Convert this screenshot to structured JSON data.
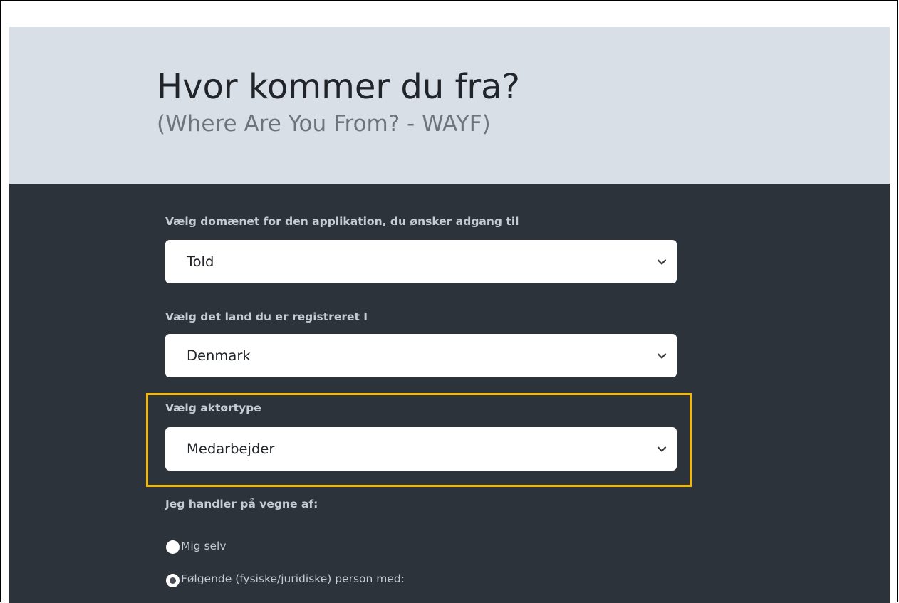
{
  "header": {
    "title": "Hvor kommer du fra?",
    "subtitle": "(Where Are You From? - WAYF)"
  },
  "form": {
    "domain": {
      "label": "Vælg domænet for den applikation, du ønsker adgang til",
      "selected": "Told"
    },
    "country": {
      "label": "Vælg det land du er registreret I",
      "selected": "Denmark"
    },
    "actor_type": {
      "label": "Vælg aktørtype",
      "selected": "Medarbejder"
    },
    "on_behalf": {
      "label": "Jeg handler på vegne af:",
      "options": [
        {
          "label": "Mig selv",
          "checked": false
        },
        {
          "label": "Følgende (fysiske/juridiske) person med:",
          "checked": true
        }
      ]
    }
  },
  "colors": {
    "header_bg": "#d9dfe7",
    "panel_bg": "#2d333b",
    "highlight": "#f5b800"
  },
  "icons": {
    "select_chevron": "chevron-down-icon"
  }
}
